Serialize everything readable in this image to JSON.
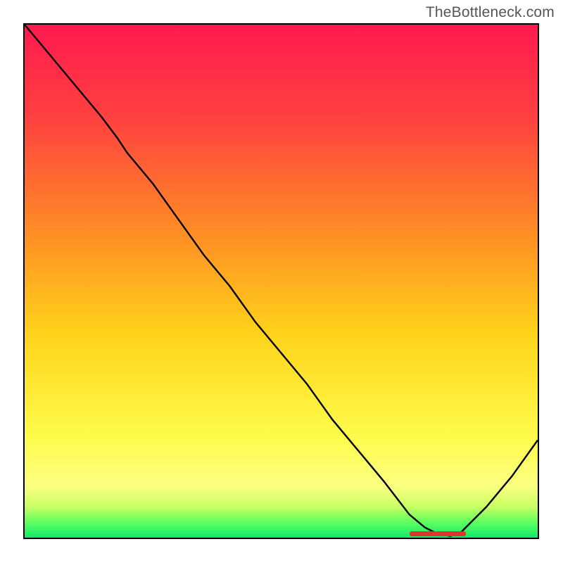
{
  "watermark": "TheBottleneck.com",
  "chart_data": {
    "type": "line",
    "title": "",
    "xlabel": "",
    "ylabel": "",
    "xlim": [
      0,
      100
    ],
    "ylim": [
      0,
      100
    ],
    "grid": false,
    "gradient_description": "vertical red-to-green background indicating bottleneck severity (top = high, bottom = none)",
    "series": [
      {
        "name": "bottleneck-curve",
        "color": "#000000",
        "x": [
          0,
          5,
          10,
          15,
          18,
          20,
          25,
          30,
          35,
          40,
          45,
          50,
          55,
          60,
          65,
          70,
          75,
          78,
          80,
          82,
          83,
          85,
          90,
          95,
          100
        ],
        "y": [
          100,
          94,
          88,
          82,
          78,
          75,
          69,
          62,
          55,
          49,
          42,
          36,
          30,
          23,
          17,
          11,
          4.5,
          2,
          1,
          0.5,
          0.3,
          1,
          6,
          12,
          19
        ]
      }
    ],
    "marker": {
      "name": "optimal-range",
      "x_start": 75,
      "x_end": 86,
      "y": 0.8,
      "color": "#d8392c"
    }
  }
}
